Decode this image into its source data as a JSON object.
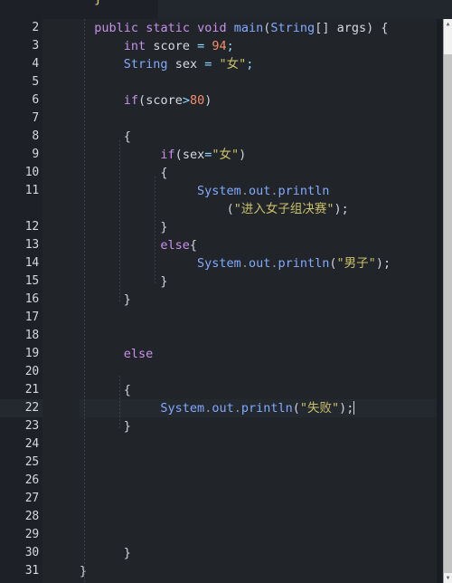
{
  "editor": {
    "theme_name": "dark-material",
    "colors": {
      "background": "#212429",
      "gutter_background": "#1d2026",
      "current_line": "#24282f",
      "keyword": "#c792ea",
      "type": "#82aaff",
      "identifier": "#d7dae0",
      "operator": "#89ddff",
      "number": "#f78c6c",
      "string": "#c9c06a",
      "punctuation": "#d0d4db",
      "line_number": "#d5d8dc",
      "caret": "#cfd3da"
    },
    "current_line_number": 22,
    "fold_marker": "▾",
    "clipped_top_glyph": "}",
    "scrollbar": {
      "up_arrow": "▲",
      "down_arrow": "▼"
    },
    "lines": [
      {
        "number": "2",
        "fold": true,
        "indent": 0,
        "current": false,
        "tokens": [
          {
            "t": "  ",
            "c": "pun"
          },
          {
            "t": "public",
            "c": "kw"
          },
          {
            "t": " ",
            "c": "pun"
          },
          {
            "t": "static",
            "c": "kw"
          },
          {
            "t": " ",
            "c": "pun"
          },
          {
            "t": "void",
            "c": "kw"
          },
          {
            "t": " ",
            "c": "pun"
          },
          {
            "t": "main",
            "c": "typ"
          },
          {
            "t": "(",
            "c": "pun"
          },
          {
            "t": "String",
            "c": "typ"
          },
          {
            "t": "[] ",
            "c": "pun"
          },
          {
            "t": "args",
            "c": "id"
          },
          {
            "t": ") ",
            "c": "pun"
          },
          {
            "t": "{",
            "c": "brc"
          }
        ]
      },
      {
        "number": "3",
        "fold": false,
        "indent": 1,
        "current": false,
        "tokens": [
          {
            "t": "      ",
            "c": "pun"
          },
          {
            "t": "int",
            "c": "kw"
          },
          {
            "t": " ",
            "c": "pun"
          },
          {
            "t": "score",
            "c": "id"
          },
          {
            "t": " ",
            "c": "pun"
          },
          {
            "t": "=",
            "c": "op"
          },
          {
            "t": " ",
            "c": "pun"
          },
          {
            "t": "94",
            "c": "num2"
          },
          {
            "t": ";",
            "c": "op"
          }
        ]
      },
      {
        "number": "4",
        "fold": false,
        "indent": 1,
        "current": false,
        "tokens": [
          {
            "t": "      ",
            "c": "pun"
          },
          {
            "t": "String",
            "c": "typ"
          },
          {
            "t": " ",
            "c": "pun"
          },
          {
            "t": "sex",
            "c": "id"
          },
          {
            "t": " ",
            "c": "pun"
          },
          {
            "t": "=",
            "c": "op"
          },
          {
            "t": " ",
            "c": "pun"
          },
          {
            "t": "\"女\"",
            "c": "str"
          },
          {
            "t": ";",
            "c": "op"
          }
        ]
      },
      {
        "number": "5",
        "fold": false,
        "indent": 1,
        "current": false,
        "tokens": []
      },
      {
        "number": "6",
        "fold": false,
        "indent": 1,
        "current": false,
        "tokens": [
          {
            "t": "      ",
            "c": "pun"
          },
          {
            "t": "if",
            "c": "kw"
          },
          {
            "t": "(",
            "c": "pun"
          },
          {
            "t": "score",
            "c": "id"
          },
          {
            "t": ">",
            "c": "op"
          },
          {
            "t": "80",
            "c": "num2"
          },
          {
            "t": ")",
            "c": "pun"
          }
        ]
      },
      {
        "number": "7",
        "fold": false,
        "indent": 1,
        "current": false,
        "tokens": []
      },
      {
        "number": "8",
        "fold": true,
        "indent": 1,
        "current": false,
        "tokens": [
          {
            "t": "      ",
            "c": "pun"
          },
          {
            "t": "{",
            "c": "brc"
          }
        ]
      },
      {
        "number": "9",
        "fold": false,
        "indent": 2,
        "current": false,
        "tokens": [
          {
            "t": "           ",
            "c": "pun"
          },
          {
            "t": "if",
            "c": "kw"
          },
          {
            "t": "(",
            "c": "pun"
          },
          {
            "t": "sex",
            "c": "id"
          },
          {
            "t": "=",
            "c": "op"
          },
          {
            "t": "\"女\"",
            "c": "str"
          },
          {
            "t": ")",
            "c": "pun"
          }
        ]
      },
      {
        "number": "10",
        "fold": true,
        "indent": 2,
        "current": false,
        "tokens": [
          {
            "t": "           ",
            "c": "pun"
          },
          {
            "t": "{",
            "c": "brc"
          }
        ]
      },
      {
        "number": "11",
        "fold": false,
        "indent": 3,
        "current": false,
        "tokens": [
          {
            "t": "                ",
            "c": "pun"
          },
          {
            "t": "System",
            "c": "typ"
          },
          {
            "t": ".",
            "c": "dot"
          },
          {
            "t": "out",
            "c": "typ"
          },
          {
            "t": ".",
            "c": "dot"
          },
          {
            "t": "println",
            "c": "typ"
          }
        ]
      },
      {
        "number": "",
        "fold": false,
        "indent": 3,
        "current": false,
        "wrapped": true,
        "tokens": [
          {
            "t": "                    ",
            "c": "pun"
          },
          {
            "t": "(",
            "c": "pun"
          },
          {
            "t": "\"进入女子组决赛\"",
            "c": "str"
          },
          {
            "t": ");",
            "c": "pun"
          }
        ]
      },
      {
        "number": "12",
        "fold": false,
        "indent": 2,
        "current": false,
        "tokens": [
          {
            "t": "           ",
            "c": "pun"
          },
          {
            "t": "}",
            "c": "brc"
          }
        ]
      },
      {
        "number": "13",
        "fold": true,
        "indent": 2,
        "current": false,
        "tokens": [
          {
            "t": "           ",
            "c": "pun"
          },
          {
            "t": "else",
            "c": "kw"
          },
          {
            "t": "{",
            "c": "brc"
          }
        ]
      },
      {
        "number": "14",
        "fold": false,
        "indent": 3,
        "current": false,
        "tokens": [
          {
            "t": "                ",
            "c": "pun"
          },
          {
            "t": "System",
            "c": "typ"
          },
          {
            "t": ".",
            "c": "dot"
          },
          {
            "t": "out",
            "c": "typ"
          },
          {
            "t": ".",
            "c": "dot"
          },
          {
            "t": "println",
            "c": "typ"
          },
          {
            "t": "(",
            "c": "pun"
          },
          {
            "t": "\"男子\"",
            "c": "str"
          },
          {
            "t": ");",
            "c": "pun"
          }
        ]
      },
      {
        "number": "15",
        "fold": false,
        "indent": 2,
        "current": false,
        "tokens": [
          {
            "t": "           ",
            "c": "pun"
          },
          {
            "t": "}",
            "c": "brc"
          }
        ]
      },
      {
        "number": "16",
        "fold": false,
        "indent": 1,
        "current": false,
        "tokens": [
          {
            "t": "      ",
            "c": "pun"
          },
          {
            "t": "}",
            "c": "brc"
          }
        ]
      },
      {
        "number": "17",
        "fold": false,
        "indent": 1,
        "current": false,
        "tokens": []
      },
      {
        "number": "18",
        "fold": false,
        "indent": 1,
        "current": false,
        "tokens": []
      },
      {
        "number": "19",
        "fold": false,
        "indent": 1,
        "current": false,
        "tokens": [
          {
            "t": "      ",
            "c": "pun"
          },
          {
            "t": "else",
            "c": "kw"
          }
        ]
      },
      {
        "number": "20",
        "fold": false,
        "indent": 1,
        "current": false,
        "tokens": []
      },
      {
        "number": "21",
        "fold": true,
        "indent": 1,
        "current": false,
        "tokens": [
          {
            "t": "      ",
            "c": "pun"
          },
          {
            "t": "{",
            "c": "brc"
          }
        ]
      },
      {
        "number": "22",
        "fold": false,
        "indent": 2,
        "current": true,
        "caret": true,
        "tokens": [
          {
            "t": "           ",
            "c": "pun"
          },
          {
            "t": "System",
            "c": "typ"
          },
          {
            "t": ".",
            "c": "dot"
          },
          {
            "t": "out",
            "c": "typ"
          },
          {
            "t": ".",
            "c": "dot"
          },
          {
            "t": "println",
            "c": "typ"
          },
          {
            "t": "(",
            "c": "pun"
          },
          {
            "t": "\"失败\"",
            "c": "str"
          },
          {
            "t": ");",
            "c": "pun"
          }
        ]
      },
      {
        "number": "23",
        "fold": false,
        "indent": 1,
        "current": false,
        "tokens": [
          {
            "t": "      ",
            "c": "pun"
          },
          {
            "t": "}",
            "c": "brc"
          }
        ]
      },
      {
        "number": "24",
        "fold": false,
        "indent": 1,
        "current": false,
        "tokens": []
      },
      {
        "number": "25",
        "fold": false,
        "indent": 1,
        "current": false,
        "tokens": []
      },
      {
        "number": "26",
        "fold": false,
        "indent": 1,
        "current": false,
        "tokens": []
      },
      {
        "number": "27",
        "fold": false,
        "indent": 1,
        "current": false,
        "tokens": []
      },
      {
        "number": "28",
        "fold": false,
        "indent": 1,
        "current": false,
        "tokens": []
      },
      {
        "number": "29",
        "fold": false,
        "indent": 1,
        "current": false,
        "tokens": []
      },
      {
        "number": "30",
        "fold": false,
        "indent": 1,
        "current": false,
        "tokens": [
          {
            "t": "      ",
            "c": "pun"
          },
          {
            "t": "}",
            "c": "brc"
          }
        ]
      },
      {
        "number": "31",
        "fold": false,
        "indent": 0,
        "current": false,
        "tokens": [
          {
            "t": "}",
            "c": "brc"
          }
        ]
      }
    ]
  }
}
